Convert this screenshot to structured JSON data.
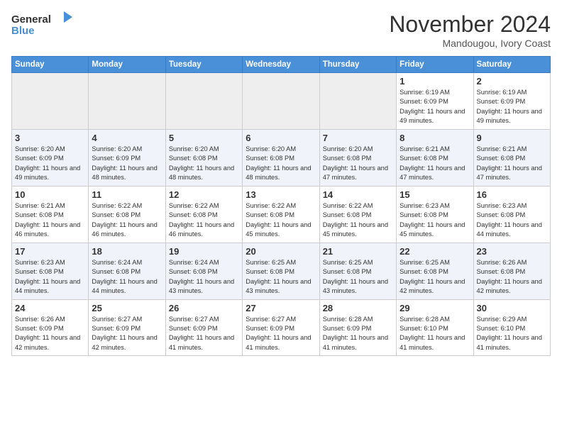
{
  "header": {
    "logo_line1": "General",
    "logo_line2": "Blue",
    "month": "November 2024",
    "location": "Mandougou, Ivory Coast"
  },
  "days_of_week": [
    "Sunday",
    "Monday",
    "Tuesday",
    "Wednesday",
    "Thursday",
    "Friday",
    "Saturday"
  ],
  "weeks": [
    {
      "row_class": "row-odd",
      "days": [
        {
          "num": "",
          "info": "",
          "empty": true
        },
        {
          "num": "",
          "info": "",
          "empty": true
        },
        {
          "num": "",
          "info": "",
          "empty": true
        },
        {
          "num": "",
          "info": "",
          "empty": true
        },
        {
          "num": "",
          "info": "",
          "empty": true
        },
        {
          "num": "1",
          "info": "Sunrise: 6:19 AM\nSunset: 6:09 PM\nDaylight: 11 hours and 49 minutes.",
          "empty": false
        },
        {
          "num": "2",
          "info": "Sunrise: 6:19 AM\nSunset: 6:09 PM\nDaylight: 11 hours and 49 minutes.",
          "empty": false
        }
      ]
    },
    {
      "row_class": "row-even",
      "days": [
        {
          "num": "3",
          "info": "Sunrise: 6:20 AM\nSunset: 6:09 PM\nDaylight: 11 hours and 49 minutes.",
          "empty": false
        },
        {
          "num": "4",
          "info": "Sunrise: 6:20 AM\nSunset: 6:09 PM\nDaylight: 11 hours and 48 minutes.",
          "empty": false
        },
        {
          "num": "5",
          "info": "Sunrise: 6:20 AM\nSunset: 6:08 PM\nDaylight: 11 hours and 48 minutes.",
          "empty": false
        },
        {
          "num": "6",
          "info": "Sunrise: 6:20 AM\nSunset: 6:08 PM\nDaylight: 11 hours and 48 minutes.",
          "empty": false
        },
        {
          "num": "7",
          "info": "Sunrise: 6:20 AM\nSunset: 6:08 PM\nDaylight: 11 hours and 47 minutes.",
          "empty": false
        },
        {
          "num": "8",
          "info": "Sunrise: 6:21 AM\nSunset: 6:08 PM\nDaylight: 11 hours and 47 minutes.",
          "empty": false
        },
        {
          "num": "9",
          "info": "Sunrise: 6:21 AM\nSunset: 6:08 PM\nDaylight: 11 hours and 47 minutes.",
          "empty": false
        }
      ]
    },
    {
      "row_class": "row-odd",
      "days": [
        {
          "num": "10",
          "info": "Sunrise: 6:21 AM\nSunset: 6:08 PM\nDaylight: 11 hours and 46 minutes.",
          "empty": false
        },
        {
          "num": "11",
          "info": "Sunrise: 6:22 AM\nSunset: 6:08 PM\nDaylight: 11 hours and 46 minutes.",
          "empty": false
        },
        {
          "num": "12",
          "info": "Sunrise: 6:22 AM\nSunset: 6:08 PM\nDaylight: 11 hours and 46 minutes.",
          "empty": false
        },
        {
          "num": "13",
          "info": "Sunrise: 6:22 AM\nSunset: 6:08 PM\nDaylight: 11 hours and 45 minutes.",
          "empty": false
        },
        {
          "num": "14",
          "info": "Sunrise: 6:22 AM\nSunset: 6:08 PM\nDaylight: 11 hours and 45 minutes.",
          "empty": false
        },
        {
          "num": "15",
          "info": "Sunrise: 6:23 AM\nSunset: 6:08 PM\nDaylight: 11 hours and 45 minutes.",
          "empty": false
        },
        {
          "num": "16",
          "info": "Sunrise: 6:23 AM\nSunset: 6:08 PM\nDaylight: 11 hours and 44 minutes.",
          "empty": false
        }
      ]
    },
    {
      "row_class": "row-even",
      "days": [
        {
          "num": "17",
          "info": "Sunrise: 6:23 AM\nSunset: 6:08 PM\nDaylight: 11 hours and 44 minutes.",
          "empty": false
        },
        {
          "num": "18",
          "info": "Sunrise: 6:24 AM\nSunset: 6:08 PM\nDaylight: 11 hours and 44 minutes.",
          "empty": false
        },
        {
          "num": "19",
          "info": "Sunrise: 6:24 AM\nSunset: 6:08 PM\nDaylight: 11 hours and 43 minutes.",
          "empty": false
        },
        {
          "num": "20",
          "info": "Sunrise: 6:25 AM\nSunset: 6:08 PM\nDaylight: 11 hours and 43 minutes.",
          "empty": false
        },
        {
          "num": "21",
          "info": "Sunrise: 6:25 AM\nSunset: 6:08 PM\nDaylight: 11 hours and 43 minutes.",
          "empty": false
        },
        {
          "num": "22",
          "info": "Sunrise: 6:25 AM\nSunset: 6:08 PM\nDaylight: 11 hours and 42 minutes.",
          "empty": false
        },
        {
          "num": "23",
          "info": "Sunrise: 6:26 AM\nSunset: 6:08 PM\nDaylight: 11 hours and 42 minutes.",
          "empty": false
        }
      ]
    },
    {
      "row_class": "row-odd",
      "days": [
        {
          "num": "24",
          "info": "Sunrise: 6:26 AM\nSunset: 6:09 PM\nDaylight: 11 hours and 42 minutes.",
          "empty": false
        },
        {
          "num": "25",
          "info": "Sunrise: 6:27 AM\nSunset: 6:09 PM\nDaylight: 11 hours and 42 minutes.",
          "empty": false
        },
        {
          "num": "26",
          "info": "Sunrise: 6:27 AM\nSunset: 6:09 PM\nDaylight: 11 hours and 41 minutes.",
          "empty": false
        },
        {
          "num": "27",
          "info": "Sunrise: 6:27 AM\nSunset: 6:09 PM\nDaylight: 11 hours and 41 minutes.",
          "empty": false
        },
        {
          "num": "28",
          "info": "Sunrise: 6:28 AM\nSunset: 6:09 PM\nDaylight: 11 hours and 41 minutes.",
          "empty": false
        },
        {
          "num": "29",
          "info": "Sunrise: 6:28 AM\nSunset: 6:10 PM\nDaylight: 11 hours and 41 minutes.",
          "empty": false
        },
        {
          "num": "30",
          "info": "Sunrise: 6:29 AM\nSunset: 6:10 PM\nDaylight: 11 hours and 41 minutes.",
          "empty": false
        }
      ]
    }
  ]
}
